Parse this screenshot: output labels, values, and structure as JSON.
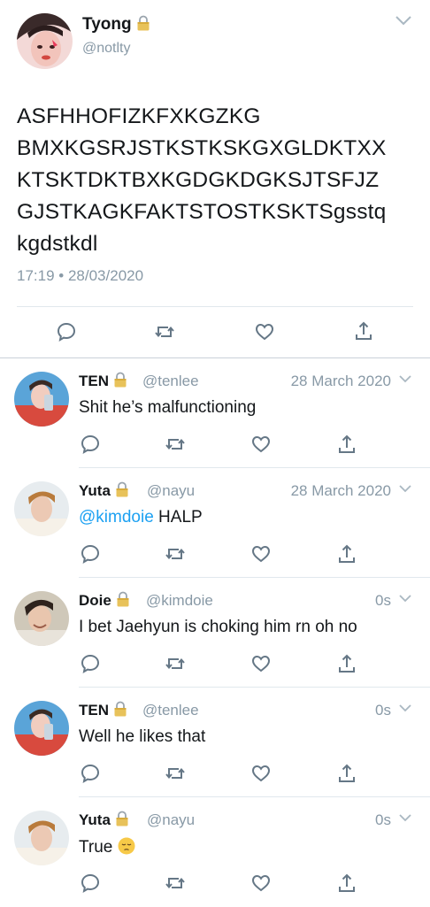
{
  "main_tweet": {
    "name": "Tyong",
    "handle": "@notlty",
    "text": "ASFHHOFIZKFXKGZKG BMXKGSRJSTKSTKSKGXGLDKTXX KTSKTDKTBXKGDGKDGKSJTSFJZ GJSTKAGKFAKTSTOSTKSKTSgsstq kgdstkdl",
    "lines": [
      "ASFHHOFIZKFXKGZKG",
      "BMXKGSRJSTKSTKSKGXGLDKTXX",
      "KTSKTDKTBXKGDGKDGKSJTSFJZ",
      "GJSTKAGKFAKTSTOSTKSKTSgsstq",
      "kgdstkdl"
    ],
    "time": "17:19",
    "date": "28/03/2020",
    "bullet": "•"
  },
  "replies": [
    {
      "name": "TEN",
      "handle": "@tenlee",
      "date": "28 March 2020",
      "mention": "",
      "text": "Shit he’s malfunctioning",
      "emoji": ""
    },
    {
      "name": "Yuta",
      "handle": "@nayu",
      "date": "28 March 2020",
      "mention": "@kimdoie",
      "text": " HALP",
      "emoji": ""
    },
    {
      "name": "Doie",
      "handle": "@kimdoie",
      "date": "0s",
      "mention": "",
      "text": "I bet Jaehyun is choking him rn oh no",
      "emoji": ""
    },
    {
      "name": "TEN",
      "handle": "@tenlee",
      "date": "0s",
      "mention": "",
      "text": "Well he likes that",
      "emoji": ""
    },
    {
      "name": "Yuta",
      "handle": "@nayu",
      "date": "0s",
      "mention": "",
      "text": "True ",
      "emoji": "pensive-face-emoji"
    }
  ],
  "icons": {
    "lock": "lock-icon",
    "caret": "chevron-down-icon",
    "reply": "reply-icon",
    "retweet": "retweet-icon",
    "like": "heart-icon",
    "share": "share-icon"
  },
  "colors": {
    "text": "#14171a",
    "secondary": "#8899a6",
    "link": "#1da1f2",
    "icon": "#657786",
    "divider": "#e1e8ed"
  }
}
